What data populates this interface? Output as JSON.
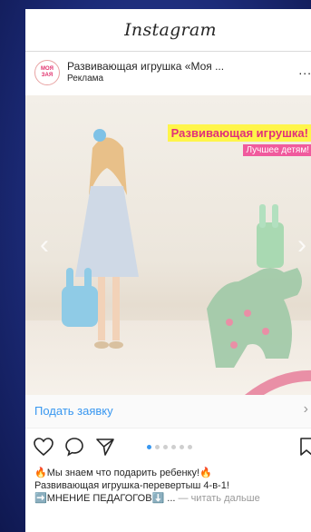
{
  "header": {
    "logo": "Instagram"
  },
  "post": {
    "avatar_lines": [
      "МОЯ",
      "ЗАЯ"
    ],
    "account_name": "Развивающая игрушка «Моя ...",
    "sponsored_label": "Реклама",
    "more_label": "..."
  },
  "image": {
    "banner_title": "Развивающая игрушка!",
    "banner_subtitle": "Лучшее детям!",
    "nav_left": "‹",
    "nav_right": "›"
  },
  "cta": {
    "label": "Подать заявку",
    "chevron": "›"
  },
  "carousel": {
    "total": 6,
    "active_index": 0
  },
  "caption": {
    "line1": "🔥Мы знаем что подарить ребенку!🔥",
    "line2": "Развивающая игрушка-перевертыш 4-в-1!",
    "line3": "➡️МНЕНИЕ ПЕДАГОГОВ⬇️ ...",
    "more_link": " — читать дальше"
  },
  "colors": {
    "link_blue": "#3897f0",
    "banner_yellow": "#fff54a",
    "banner_pink": "#f05a9d",
    "background_blue": "#1c2b78"
  },
  "icons": [
    "heart-icon",
    "comment-icon",
    "share-icon",
    "bookmark-icon"
  ]
}
